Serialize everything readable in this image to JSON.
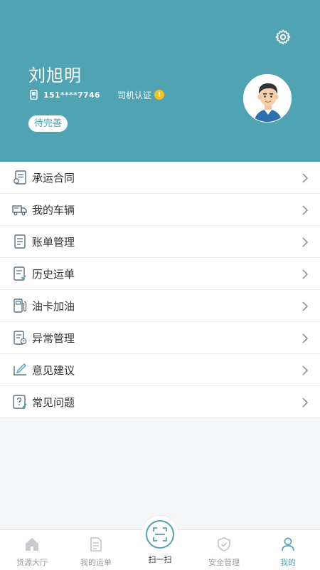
{
  "profile": {
    "name": "刘旭明",
    "phone": "151****7746",
    "cert_label": "司机认证",
    "cert_status_icon": "warning-icon",
    "status_pill": "待完善",
    "settings_icon": "gear-icon"
  },
  "menu": {
    "items": [
      {
        "label": "承运合同",
        "icon": "contract-icon"
      },
      {
        "label": "我的车辆",
        "icon": "truck-icon"
      },
      {
        "label": "账单管理",
        "icon": "bill-icon"
      },
      {
        "label": "历史运单",
        "icon": "history-order-icon"
      },
      {
        "label": "油卡加油",
        "icon": "fuel-icon"
      },
      {
        "label": "异常管理",
        "icon": "exception-icon"
      },
      {
        "label": "意见建议",
        "icon": "feedback-icon"
      },
      {
        "label": "常见问题",
        "icon": "faq-icon"
      }
    ]
  },
  "tabbar": {
    "tabs": [
      {
        "label": "货源大厅",
        "icon": "home-icon"
      },
      {
        "label": "我的运单",
        "icon": "order-icon"
      },
      {
        "label": "扫一扫",
        "icon": "scan-icon"
      },
      {
        "label": "安全管理",
        "icon": "shield-icon"
      },
      {
        "label": "我的",
        "icon": "user-icon"
      }
    ],
    "active_index": 4
  },
  "colors": {
    "brand": "#4fa3b2",
    "warning": "#f6c31d",
    "inactive_tab": "#999999"
  }
}
